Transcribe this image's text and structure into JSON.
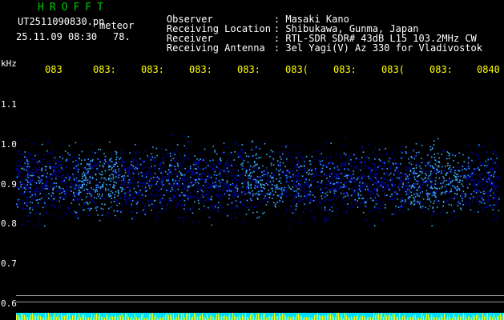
{
  "header": {
    "brand": "HROFFT",
    "filename": "UT2511090830.pn",
    "tag": "meteor",
    "datetime": "25.11.09 08:30",
    "count": "78.",
    "observer_label": "Observer",
    "observer": ": Masaki Kano",
    "location_label": "Receiving Location",
    "location": ": Shibukawa, Gunma, Japan",
    "receiver_label": "Receiver",
    "receiver": ": RTL-SDR SDR# 43dB L15 103.2MHz CW",
    "antenna_label": "Receiving Antenna",
    "antenna": ": 3el Yagi(V) Az 330 for Vladivostok"
  },
  "axis": {
    "unit": "kHz",
    "freq_ticks": [
      "1.1",
      "1.0",
      "0.9",
      "0.8",
      "0.7",
      "0.6"
    ],
    "time_ticks": [
      "083",
      "083:",
      "083:",
      "083:",
      "083:",
      "083(",
      "083:",
      "083(",
      "083:",
      "0840"
    ]
  },
  "colors": {
    "background": "#000000",
    "signal_high": "#3ab0ff",
    "signal_low": "#0000aa",
    "baseline": "#00e0ff",
    "peaks": "#ffff00",
    "text": "#ffffff",
    "brand": "#00c800",
    "time_labels": "#ffff00"
  }
}
